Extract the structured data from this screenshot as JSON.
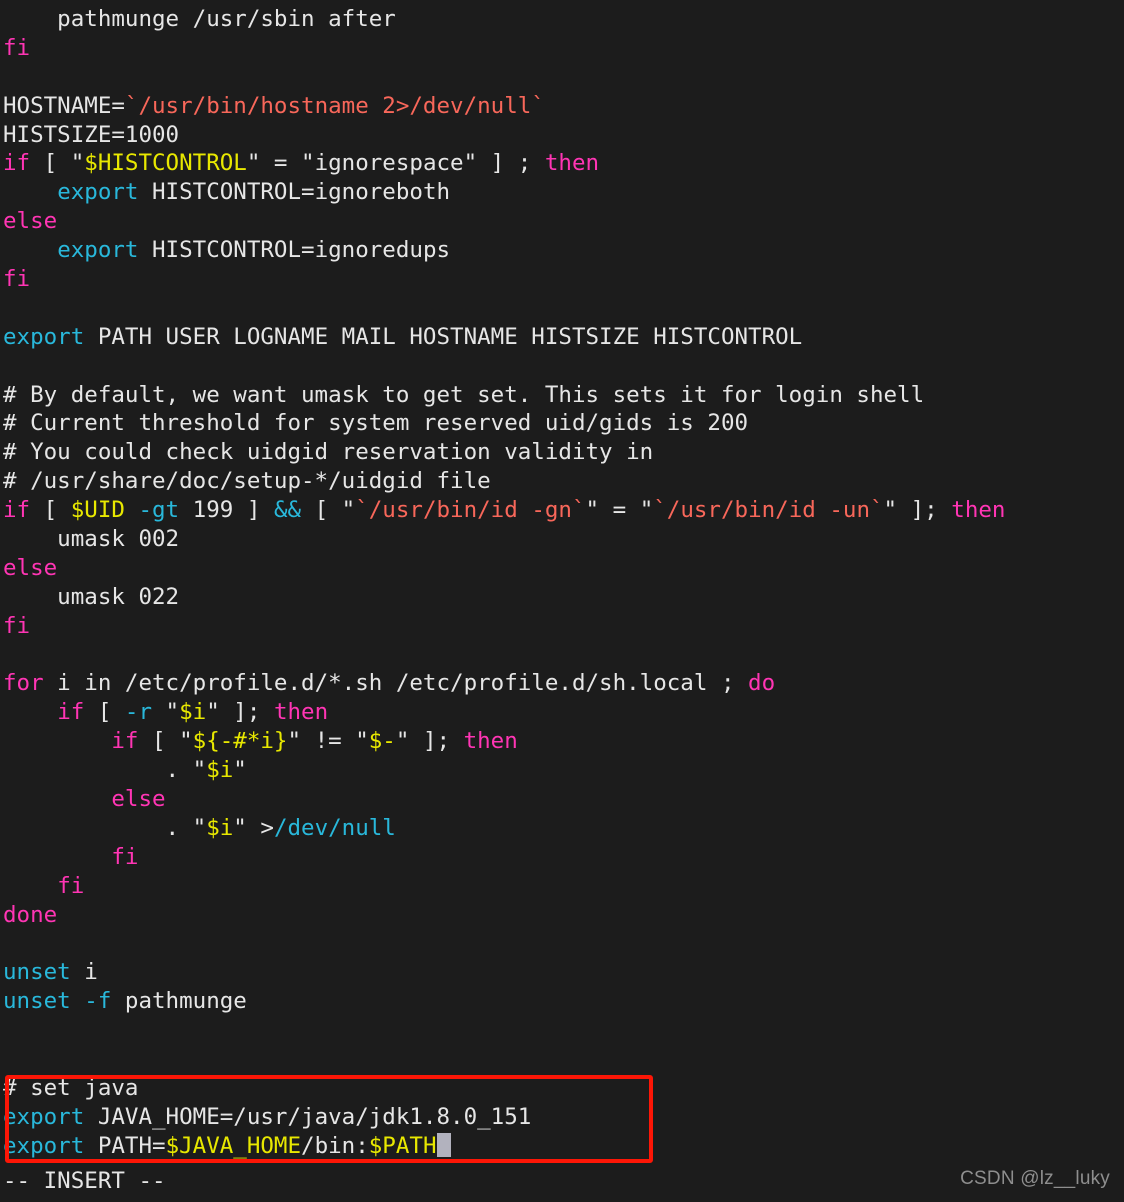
{
  "editor": {
    "name": "vim",
    "mode_label": "-- INSERT --",
    "background_color": "#1c1c1c",
    "foreground_color": "#e6e6e6",
    "cursor_color": "#b2b2be"
  },
  "colors": {
    "keyword": "#ff35b4",
    "builtin": "#29b8db",
    "variable": "#e8e800",
    "string": "#f8675a",
    "comment": "#e6e6e6",
    "plain": "#e6e6e6",
    "highlight_box": "#fc1606",
    "watermark": "#8e8e8e"
  },
  "highlight_box": {
    "present": true,
    "color": "#fc1606",
    "covers_lines": [
      "# set java",
      "export JAVA_HOME=/usr/java/jdk1.8.0_151",
      "export PATH=$JAVA_HOME/bin:$PATH"
    ]
  },
  "watermark": {
    "text": "CSDN @lz__luky"
  },
  "lines": [
    {
      "id": 0,
      "tokens": [
        {
          "c": "plain",
          "t": "    pathmunge /usr/sbin after"
        }
      ]
    },
    {
      "id": 1,
      "tokens": [
        {
          "c": "kw",
          "t": "fi"
        }
      ]
    },
    {
      "id": 2,
      "tokens": [
        {
          "c": "plain",
          "t": ""
        }
      ]
    },
    {
      "id": 3,
      "tokens": [
        {
          "c": "plain",
          "t": "HOSTNAME="
        },
        {
          "c": "str",
          "t": "`/usr/bin/hostname 2>/dev/null`"
        }
      ]
    },
    {
      "id": 4,
      "tokens": [
        {
          "c": "plain",
          "t": "HISTSIZE=1000"
        }
      ]
    },
    {
      "id": 5,
      "tokens": [
        {
          "c": "kw",
          "t": "if"
        },
        {
          "c": "plain",
          "t": " [ \""
        },
        {
          "c": "var",
          "t": "$HISTCONTROL"
        },
        {
          "c": "plain",
          "t": "\" = \"ignorespace\" ] ; "
        },
        {
          "c": "kw",
          "t": "then"
        }
      ]
    },
    {
      "id": 6,
      "tokens": [
        {
          "c": "plain",
          "t": "    "
        },
        {
          "c": "builtin",
          "t": "export"
        },
        {
          "c": "plain",
          "t": " HISTCONTROL=ignoreboth"
        }
      ]
    },
    {
      "id": 7,
      "tokens": [
        {
          "c": "kw",
          "t": "else"
        }
      ]
    },
    {
      "id": 8,
      "tokens": [
        {
          "c": "plain",
          "t": "    "
        },
        {
          "c": "builtin",
          "t": "export"
        },
        {
          "c": "plain",
          "t": " HISTCONTROL=ignoredups"
        }
      ]
    },
    {
      "id": 9,
      "tokens": [
        {
          "c": "kw",
          "t": "fi"
        }
      ]
    },
    {
      "id": 10,
      "tokens": [
        {
          "c": "plain",
          "t": ""
        }
      ]
    },
    {
      "id": 11,
      "tokens": [
        {
          "c": "builtin",
          "t": "export"
        },
        {
          "c": "plain",
          "t": " PATH USER LOGNAME MAIL HOSTNAME HISTSIZE HISTCONTROL"
        }
      ]
    },
    {
      "id": 12,
      "tokens": [
        {
          "c": "plain",
          "t": ""
        }
      ]
    },
    {
      "id": 13,
      "tokens": [
        {
          "c": "cmt",
          "t": "# By default, we want umask to get set. This sets it for login shell"
        }
      ]
    },
    {
      "id": 14,
      "tokens": [
        {
          "c": "cmt",
          "t": "# Current threshold for system reserved uid/gids is 200"
        }
      ]
    },
    {
      "id": 15,
      "tokens": [
        {
          "c": "cmt",
          "t": "# You could check uidgid reservation validity in"
        }
      ]
    },
    {
      "id": 16,
      "tokens": [
        {
          "c": "cmt",
          "t": "# /usr/share/doc/setup-*/uidgid file"
        }
      ]
    },
    {
      "id": 17,
      "tokens": [
        {
          "c": "kw",
          "t": "if"
        },
        {
          "c": "plain",
          "t": " [ "
        },
        {
          "c": "var",
          "t": "$UID"
        },
        {
          "c": "plain",
          "t": " "
        },
        {
          "c": "builtin",
          "t": "-gt"
        },
        {
          "c": "plain",
          "t": " 199 ] "
        },
        {
          "c": "builtin",
          "t": "&&"
        },
        {
          "c": "plain",
          "t": " [ \""
        },
        {
          "c": "str",
          "t": "`/usr/bin/id -gn`"
        },
        {
          "c": "plain",
          "t": "\" = \""
        },
        {
          "c": "str",
          "t": "`/usr/bin/id -un`"
        },
        {
          "c": "plain",
          "t": "\" ]; "
        },
        {
          "c": "kw",
          "t": "then"
        }
      ]
    },
    {
      "id": 18,
      "tokens": [
        {
          "c": "plain",
          "t": "    umask 002"
        }
      ]
    },
    {
      "id": 19,
      "tokens": [
        {
          "c": "kw",
          "t": "else"
        }
      ]
    },
    {
      "id": 20,
      "tokens": [
        {
          "c": "plain",
          "t": "    umask 022"
        }
      ]
    },
    {
      "id": 21,
      "tokens": [
        {
          "c": "kw",
          "t": "fi"
        }
      ]
    },
    {
      "id": 22,
      "tokens": [
        {
          "c": "plain",
          "t": ""
        }
      ]
    },
    {
      "id": 23,
      "tokens": [
        {
          "c": "kw",
          "t": "for"
        },
        {
          "c": "plain",
          "t": " i in /etc/profile.d/*.sh /etc/profile.d/sh.local ; "
        },
        {
          "c": "kw",
          "t": "do"
        }
      ]
    },
    {
      "id": 24,
      "tokens": [
        {
          "c": "plain",
          "t": "    "
        },
        {
          "c": "kw",
          "t": "if"
        },
        {
          "c": "plain",
          "t": " [ "
        },
        {
          "c": "builtin",
          "t": "-r"
        },
        {
          "c": "plain",
          "t": " \""
        },
        {
          "c": "var",
          "t": "$i"
        },
        {
          "c": "plain",
          "t": "\" ]; "
        },
        {
          "c": "kw",
          "t": "then"
        }
      ]
    },
    {
      "id": 25,
      "tokens": [
        {
          "c": "plain",
          "t": "        "
        },
        {
          "c": "kw",
          "t": "if"
        },
        {
          "c": "plain",
          "t": " [ \""
        },
        {
          "c": "var",
          "t": "${-#*i}"
        },
        {
          "c": "plain",
          "t": "\" != \""
        },
        {
          "c": "var",
          "t": "$-"
        },
        {
          "c": "plain",
          "t": "\" ]; "
        },
        {
          "c": "kw",
          "t": "then"
        }
      ]
    },
    {
      "id": 26,
      "tokens": [
        {
          "c": "plain",
          "t": "            . \""
        },
        {
          "c": "var",
          "t": "$i"
        },
        {
          "c": "plain",
          "t": "\""
        }
      ]
    },
    {
      "id": 27,
      "tokens": [
        {
          "c": "plain",
          "t": "        "
        },
        {
          "c": "kw",
          "t": "else"
        }
      ]
    },
    {
      "id": 28,
      "tokens": [
        {
          "c": "plain",
          "t": "            . \""
        },
        {
          "c": "var",
          "t": "$i"
        },
        {
          "c": "plain",
          "t": "\" >"
        },
        {
          "c": "path",
          "t": "/dev/null"
        }
      ]
    },
    {
      "id": 29,
      "tokens": [
        {
          "c": "plain",
          "t": "        "
        },
        {
          "c": "kw",
          "t": "fi"
        }
      ]
    },
    {
      "id": 30,
      "tokens": [
        {
          "c": "plain",
          "t": "    "
        },
        {
          "c": "kw",
          "t": "fi"
        }
      ]
    },
    {
      "id": 31,
      "tokens": [
        {
          "c": "kw",
          "t": "done"
        }
      ]
    },
    {
      "id": 32,
      "tokens": [
        {
          "c": "plain",
          "t": ""
        }
      ]
    },
    {
      "id": 33,
      "tokens": [
        {
          "c": "builtin",
          "t": "unset"
        },
        {
          "c": "plain",
          "t": " i"
        }
      ]
    },
    {
      "id": 34,
      "tokens": [
        {
          "c": "builtin",
          "t": "unset"
        },
        {
          "c": "plain",
          "t": " "
        },
        {
          "c": "builtin",
          "t": "-f"
        },
        {
          "c": "plain",
          "t": " pathmunge"
        }
      ]
    },
    {
      "id": 35,
      "tokens": [
        {
          "c": "plain",
          "t": ""
        }
      ]
    },
    {
      "id": 36,
      "tokens": [
        {
          "c": "plain",
          "t": ""
        }
      ]
    },
    {
      "id": 37,
      "tokens": [
        {
          "c": "cmt",
          "t": "# set java"
        }
      ]
    },
    {
      "id": 38,
      "tokens": [
        {
          "c": "builtin",
          "t": "export"
        },
        {
          "c": "plain",
          "t": " JAVA_HOME=/usr/java/jdk1.8.0_151"
        }
      ]
    },
    {
      "id": 39,
      "tokens": [
        {
          "c": "builtin",
          "t": "export"
        },
        {
          "c": "plain",
          "t": " PATH="
        },
        {
          "c": "var",
          "t": "$JAVA_HOME"
        },
        {
          "c": "plain",
          "t": "/bin:"
        },
        {
          "c": "var",
          "t": "$PATH"
        },
        {
          "c": "cursor",
          "t": ""
        }
      ]
    }
  ]
}
